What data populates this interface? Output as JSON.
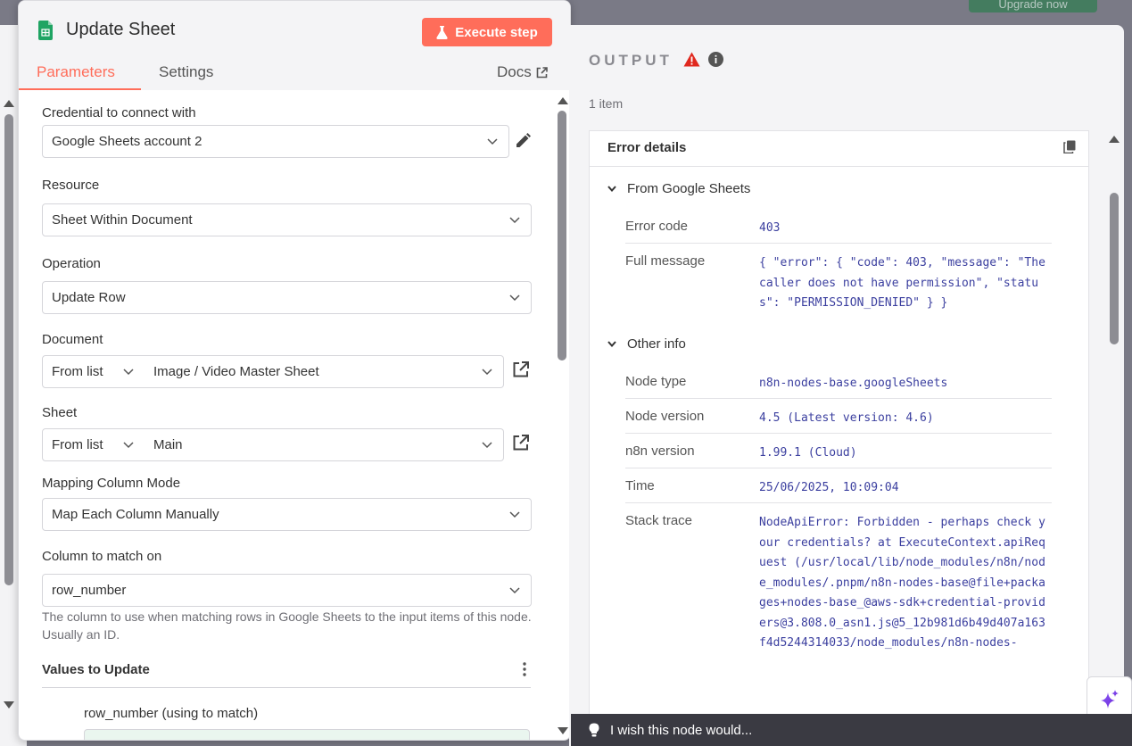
{
  "top": {
    "upgrade_label": "Upgrade now"
  },
  "node": {
    "title": "Update Sheet",
    "execute_label": "Execute step",
    "tabs": [
      "Parameters",
      "Settings"
    ],
    "docs_label": "Docs"
  },
  "params": {
    "credential": {
      "label": "Credential to connect with",
      "value": "Google Sheets account 2"
    },
    "resource": {
      "label": "Resource",
      "value": "Sheet Within Document"
    },
    "operation": {
      "label": "Operation",
      "value": "Update Row"
    },
    "document": {
      "label": "Document",
      "mode": "From list",
      "value": "Image / Video Master Sheet"
    },
    "sheet": {
      "label": "Sheet",
      "mode": "From list",
      "value": "Main"
    },
    "mapping": {
      "label": "Mapping Column Mode",
      "value": "Map Each Column Manually"
    },
    "match_column": {
      "label": "Column to match on",
      "value": "row_number",
      "hint": "The column to use when matching rows in Google Sheets to the input items of this node. Usually an ID."
    },
    "values_title": "Values to Update",
    "row_number_label": "row_number (using to match)"
  },
  "output": {
    "title": "OUTPUT",
    "item_count": "1 item",
    "error_title": "Error details",
    "section1": "From Google Sheets",
    "error_code_key": "Error code",
    "error_code_val": "403",
    "full_message_key": "Full message",
    "full_message_val": "{ \"error\": { \"code\": 403, \"message\": \"The caller does not have permission\", \"status\": \"PERMISSION_DENIED\" } }",
    "section2": "Other info",
    "node_type_key": "Node type",
    "node_type_val": "n8n-nodes-base.googleSheets",
    "node_version_key": "Node version",
    "node_version_val": "4.5 (Latest version: 4.6)",
    "n8n_version_key": "n8n version",
    "n8n_version_val": "1.99.1 (Cloud)",
    "time_key": "Time",
    "time_val": "25/06/2025, 10:09:04",
    "stack_key": "Stack trace",
    "stack_val": "NodeApiError: Forbidden - perhaps check your credentials? at ExecuteContext.apiRequest (/usr/local/lib/node_modules/n8n/node_modules/.pnpm/n8n-nodes-base@file+packages+nodes-base_@aws-sdk+credential-providers@3.808.0_asn1.js@5_12b981d6b49d407a163f4d5244314033/node_modules/n8n-nodes-"
  },
  "feedback": {
    "label": "I wish this node would..."
  },
  "colors": {
    "accent": "#ff6d5a",
    "code": "#3b3f9f"
  }
}
